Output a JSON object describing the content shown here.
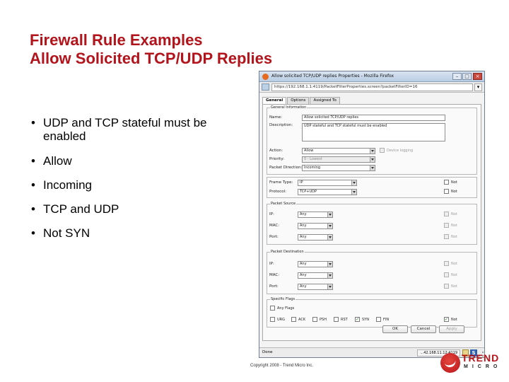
{
  "slide": {
    "title_line1": "Firewall Rule Examples",
    "title_line2": "Allow Solicited TCP/UDP Replies",
    "bullets": [
      "UDP and TCP stateful must be enabled",
      "Allow",
      "Incoming",
      "TCP and UDP",
      "Not SYN"
    ]
  },
  "browser": {
    "window_title": "Allow solicited TCP/UDP replies Properties - Mozilla Firefox",
    "url": "https://192.168.1.1:4119/PacketFilterProperties.screen?packetFilterID=16",
    "tabs": [
      "General",
      "Options",
      "Assigned To"
    ],
    "general_information": {
      "heading": "General Information",
      "name_label": "Name:",
      "name_value": "Allow solicited TCP/UDP replies",
      "description_label": "Description:",
      "description_value": "UDP stateful and TCP stateful must be enabled",
      "action_label": "Action:",
      "action_value": "Allow",
      "device_logging_label": "Device logging",
      "priority_label": "Priority:",
      "priority_value": "0 - Lowest",
      "direction_label": "Packet Direction:",
      "direction_value": "Incoming",
      "frame_type_label": "Frame Type:",
      "frame_type_value": "IP",
      "protocol_label": "Protocol:",
      "protocol_value": "TCP+UDP",
      "not_label": "Not"
    },
    "packet_source": {
      "heading": "Packet Source",
      "ip_label": "IP:",
      "ip_value": "Any",
      "mac_label": "MAC:",
      "mac_value": "Any",
      "port_label": "Port:",
      "port_value": "Any",
      "not_label": "Not"
    },
    "packet_destination": {
      "heading": "Packet Destination",
      "ip_label": "IP:",
      "ip_value": "Any",
      "mac_label": "MAC:",
      "mac_value": "Any",
      "port_label": "Port:",
      "port_value": "Any",
      "not_label": "Not"
    },
    "specific_flags": {
      "heading": "Specific Flags",
      "any_flags_label": "Any Flags",
      "flags": [
        "URG",
        "ACK",
        "PSH",
        "RST",
        "SYN",
        "FIN"
      ],
      "flags_checked": [
        "SYN"
      ],
      "not_label": "Not",
      "not_checked": true
    },
    "buttons": {
      "ok": "OK",
      "cancel": "Cancel",
      "apply": "Apply"
    },
    "status": {
      "text": "Done",
      "host": "...42.168.11.12:4119",
      "s_badge": "S"
    }
  },
  "footer": {
    "copyright": "Copyright 2008 - Trend Micro Inc.",
    "logo_line1": "TREND",
    "logo_line2": "MICRO"
  },
  "colors": {
    "title": "#b3131b",
    "logo_red": "#b9131a",
    "window_border": "#6f7f90"
  }
}
